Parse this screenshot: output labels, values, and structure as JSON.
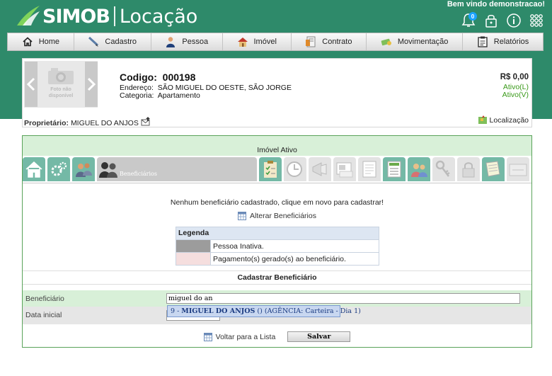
{
  "app": {
    "brand": "SIMOB",
    "module": "Locação",
    "welcome": "Bem vindo demonstracao!",
    "notification_count": "0"
  },
  "nav": [
    {
      "label": "Home",
      "icon": "home-icon"
    },
    {
      "label": "Cadastro",
      "icon": "pencil-icon"
    },
    {
      "label": "Pessoa",
      "icon": "person-icon"
    },
    {
      "label": "Imóvel",
      "icon": "house-icon"
    },
    {
      "label": "Contrato",
      "icon": "contract-icon"
    },
    {
      "label": "Movimentação",
      "icon": "money-icon"
    },
    {
      "label": "Relatórios",
      "icon": "report-icon"
    }
  ],
  "property": {
    "no_photo": "Foto não disponível",
    "code_label": "Codigo:",
    "code": "000198",
    "address_label": "Endereço:",
    "address": "SÃO MIGUEL DO OESTE, SÃO JORGE",
    "category_label": "Categoria:",
    "category": "Apartamento",
    "price": "R$ 0,00",
    "status_l": "Ativo(L)",
    "status_v": "Ativo(V)",
    "owner_label": "Proprietário:",
    "owner": "MIGUEL DO ANJOS",
    "location_label": "Localização"
  },
  "panel": {
    "title": "Imóvel Ativo",
    "active_tab": "Beneficiários",
    "empty_message": "Nenhum beneficiário cadastrado, clique em novo para cadastrar!",
    "alter_label": "Alterar Beneficiários",
    "legend": {
      "title": "Legenda",
      "rows": [
        {
          "label": "Pessoa Inativa.",
          "color": "#9c9c9c"
        },
        {
          "label": "Pagamento(s) gerado(s) ao beneficiário.",
          "color": "#f5dede"
        }
      ]
    },
    "form": {
      "section_title": "Cadastrar Beneficiário",
      "beneficiary_label": "Beneficiário",
      "beneficiary_value": "miguel do an",
      "start_date_label": "Data inicial",
      "start_date_value": "",
      "autocomplete": {
        "prefix": "9 - ",
        "match": "MIGUEL DO AN",
        "rest": "JOS",
        "suffix": " () (AGÊNCIA: Carteira - Dia 1)"
      },
      "back_label": "Voltar para a Lista",
      "save_label": "Salvar"
    }
  },
  "colors": {
    "brand_green": "#2e8a6a",
    "panel_green": "#d8f0d8",
    "status_green": "#3a9a1a"
  }
}
